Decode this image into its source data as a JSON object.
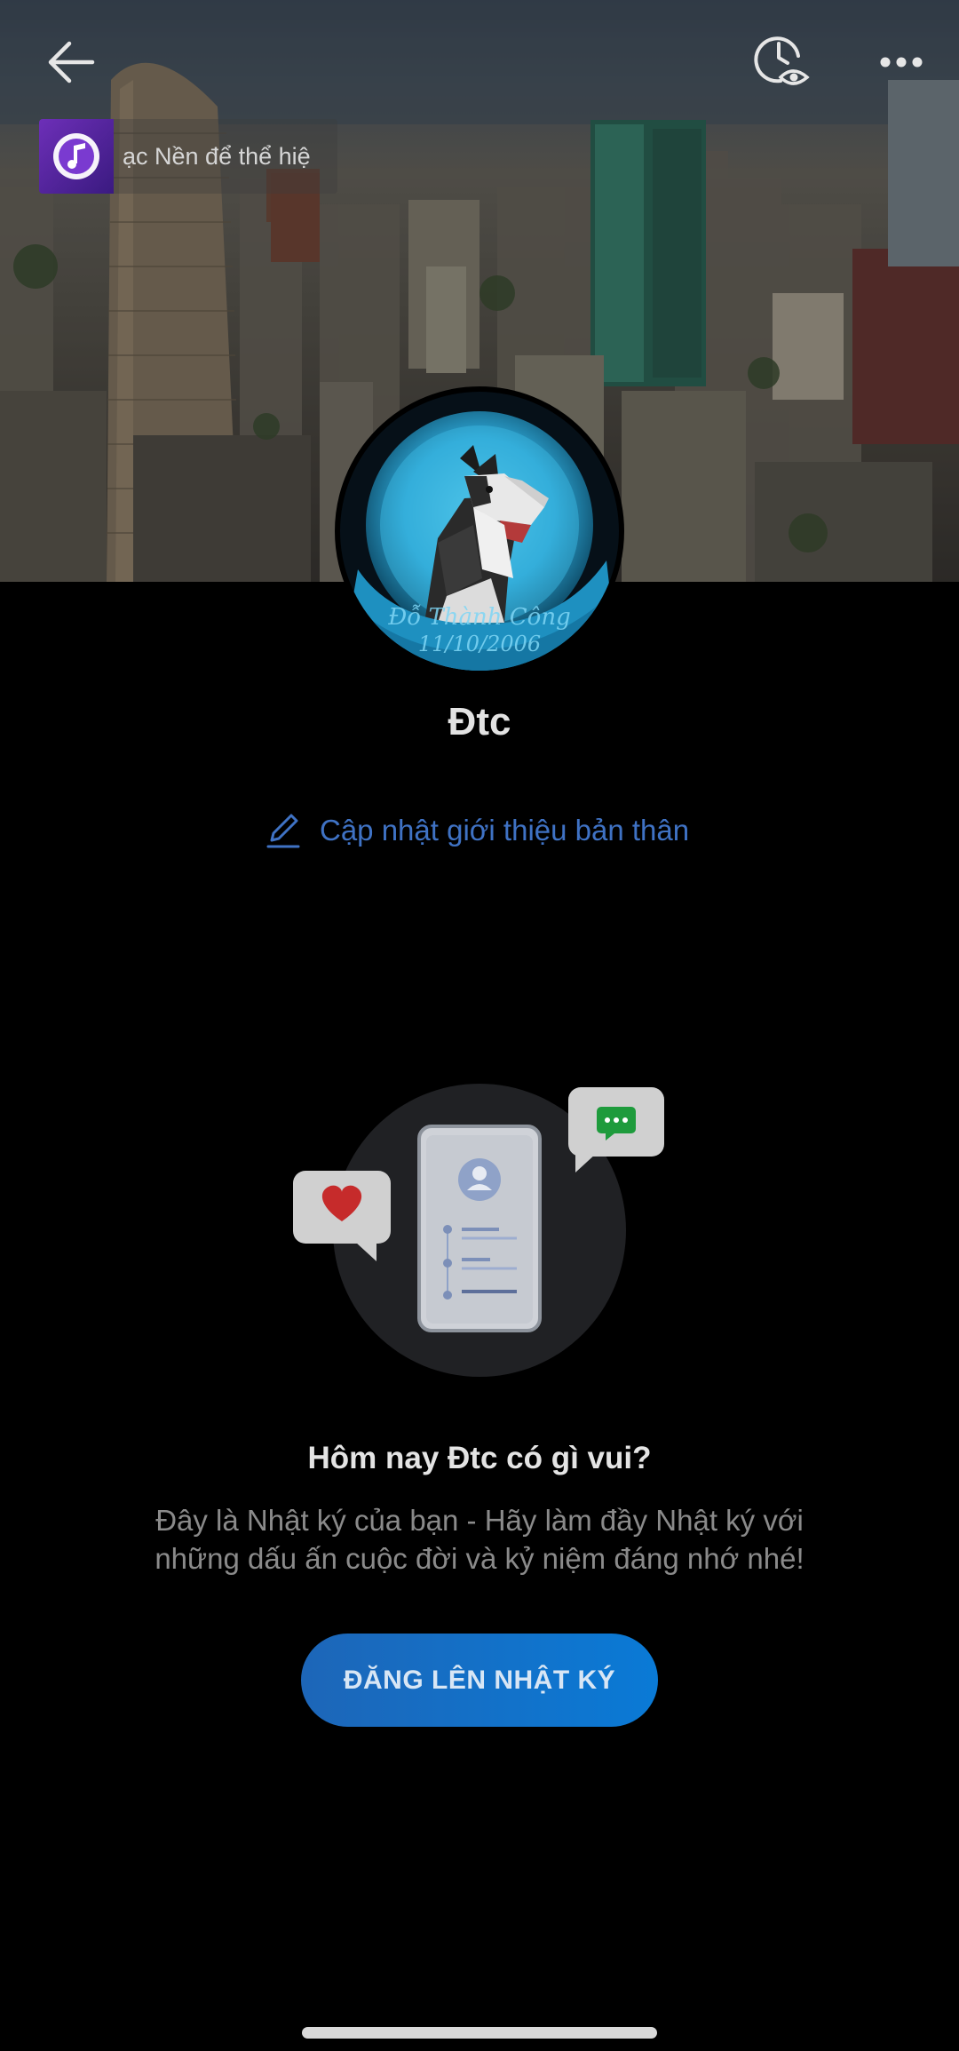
{
  "header": {
    "back_icon": "arrow-left-icon",
    "visitors_icon": "clock-eye-icon",
    "more_icon": "more-horizontal-icon"
  },
  "music": {
    "icon": "music-note-icon",
    "text": "ạc Nền để thể hiệ"
  },
  "avatar": {
    "caption_name": "Đỗ Thành Công",
    "caption_date": "11/10/2006"
  },
  "profile": {
    "name": "Đtc",
    "bio_link": "Cập nhật giới thiệu bản thân",
    "bio_icon": "pencil-icon"
  },
  "empty_state": {
    "headline": "Hôm nay Đtc có gì vui?",
    "description": "Đây là Nhật ký của bạn - Hãy làm đầy Nhật ký với những dấu ấn cuộc đời và kỷ niệm đáng nhớ nhé!",
    "button_label": "ĐĂNG LÊN NHẬT KÝ"
  },
  "colors": {
    "accent_blue": "#3f72c4",
    "button_blue": "#0a7ad6",
    "heart_red": "#c62b2b",
    "chat_green": "#1e9b3c"
  }
}
